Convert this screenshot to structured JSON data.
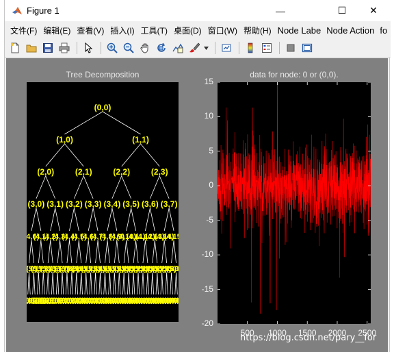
{
  "window": {
    "title": "Figure 1",
    "minimize": "—",
    "maximize": "☐",
    "close": "✕"
  },
  "menu": [
    "文件(F)",
    "编辑(E)",
    "查看(V)",
    "插入(I)",
    "工具(T)",
    "桌面(D)",
    "窗口(W)",
    "帮助(H)"
  ],
  "menu_extra": [
    "Node Labe",
    "Node Action",
    "fo"
  ],
  "toolbar_icons": [
    "new-figure-icon",
    "open-file-icon",
    "save-icon",
    "print-icon",
    "separator",
    "pointer-icon",
    "separator",
    "zoom-in-icon",
    "zoom-out-icon",
    "pan-icon",
    "rotate-icon",
    "data-cursor-icon",
    "brush-icon",
    "separator",
    "link-plot-icon",
    "separator",
    "colorbar-icon",
    "legend-icon",
    "separator",
    "hide-plot-tools-icon",
    "show-plot-tools-icon"
  ],
  "left_axes": {
    "title": "Tree Decomposition",
    "level0": [
      "(0,0)"
    ],
    "level1": [
      "(1,0)",
      "(1,1)"
    ],
    "level2": [
      "(2,0)",
      "(2,1)",
      "(2,2)",
      "(2,3)"
    ],
    "level3": [
      "(3,0)",
      "(3,1)",
      "(3,2)",
      "(3,3)",
      "(3,4)",
      "(3,5)",
      "(3,6)",
      "(3,7)"
    ],
    "level4": [
      "(4,0)",
      "(4,1)",
      "(4,2)",
      "(4,3)",
      "(4,4)",
      "(4,5)",
      "(4,6)",
      "(4,7)",
      "(4,8)",
      "(4,9)",
      "(4,10)",
      "(4,11)",
      "(4,12)",
      "(4,13)",
      "(4,14)",
      "(4,15)"
    ]
  },
  "chart_data": {
    "type": "line",
    "title": "data for node: 0 or (0,0).",
    "xlim": [
      1,
      2560
    ],
    "ylim": [
      -20,
      15
    ],
    "xticks": [
      500,
      1000,
      1500,
      2000,
      2500
    ],
    "yticks": [
      15,
      10,
      5,
      0,
      -5,
      -10,
      -15,
      -20
    ],
    "series": [
      {
        "color": "#ff0000",
        "n_points": 2560,
        "envelope_typical": [
          -5,
          5
        ],
        "spikes": [
          [
            1000,
            15
          ],
          [
            985,
            -18
          ],
          [
            720,
            -18.5
          ],
          [
            880,
            -17
          ]
        ]
      }
    ],
    "grid": false,
    "background": "#000000"
  },
  "watermark": "https://blog.csdn.net/pary__for",
  "colors": {
    "figure_bg": "#808080",
    "axes_bg": "#000000",
    "node_label": "#ffff00",
    "tree_line": "#ffffff",
    "signal": "#ff0000"
  }
}
